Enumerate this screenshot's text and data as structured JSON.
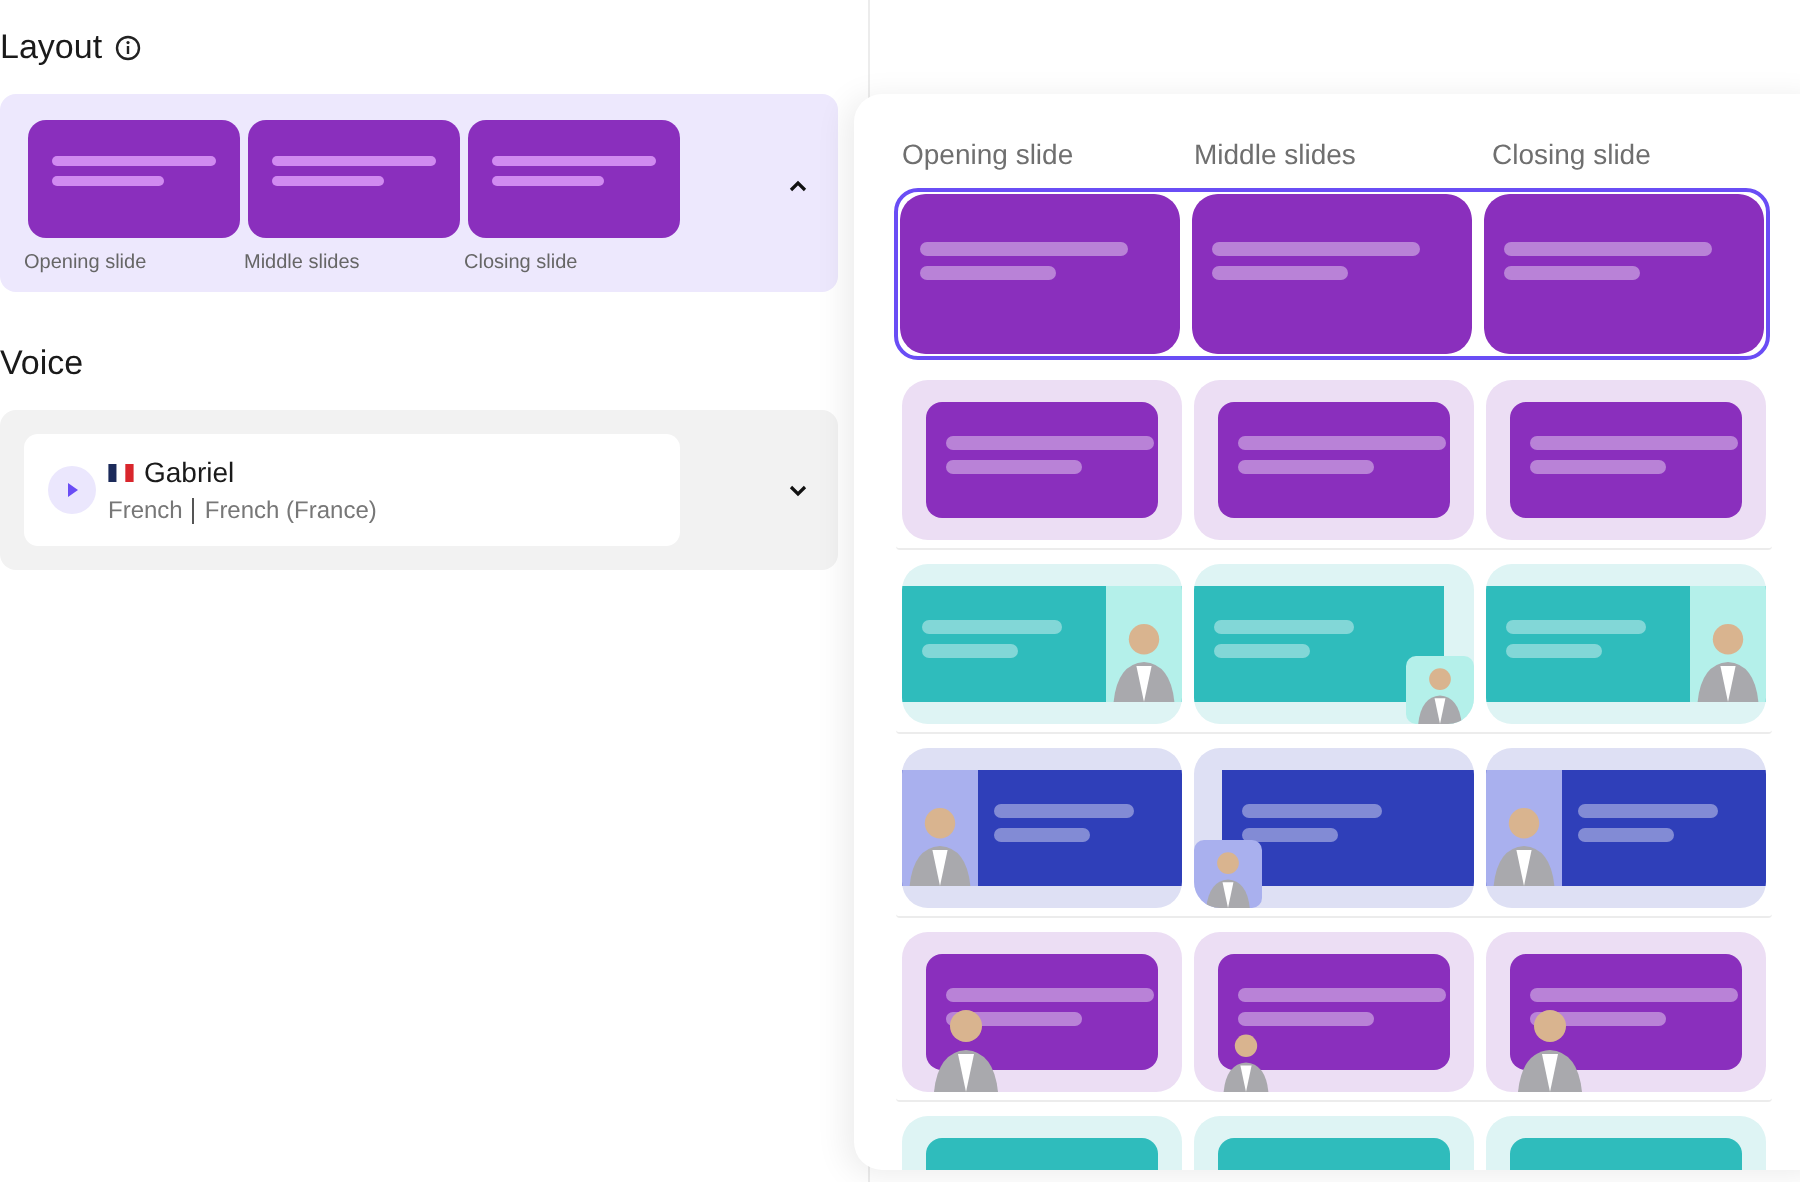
{
  "layout": {
    "title": "Layout",
    "selected_slides": [
      {
        "label": "Opening slide"
      },
      {
        "label": "Middle slides"
      },
      {
        "label": "Closing slide"
      }
    ],
    "expanded": true
  },
  "voice": {
    "title": "Voice",
    "name": "Gabriel",
    "language": "French",
    "locale": "French (France)",
    "expanded": false
  },
  "picker": {
    "columns": [
      "Opening slide",
      "Middle slides",
      "Closing slide"
    ],
    "rows": [
      {
        "selected": true,
        "color": "#8a2fbd",
        "cells": [
          {
            "kind": "full"
          },
          {
            "kind": "full"
          },
          {
            "kind": "full"
          }
        ]
      },
      {
        "selected": false,
        "color": "#8a2fbd",
        "cells": [
          {
            "kind": "inset"
          },
          {
            "kind": "inset"
          },
          {
            "kind": "inset"
          }
        ]
      },
      {
        "selected": false,
        "color": "#2fbcbc",
        "cells": [
          {
            "kind": "avatar-right"
          },
          {
            "kind": "corner-right"
          },
          {
            "kind": "avatar-right"
          }
        ]
      },
      {
        "selected": false,
        "color": "#2f3fb9",
        "cells": [
          {
            "kind": "avatar-left"
          },
          {
            "kind": "corner-left"
          },
          {
            "kind": "avatar-left"
          }
        ]
      },
      {
        "selected": false,
        "color": "#8a2fbd",
        "cells": [
          {
            "kind": "bottom-left"
          },
          {
            "kind": "bottom-left-small"
          },
          {
            "kind": "bottom-left"
          }
        ]
      },
      {
        "selected": false,
        "color": "#2fbcbc",
        "cells": [
          {
            "kind": "inset"
          },
          {
            "kind": "inset"
          },
          {
            "kind": "inset"
          }
        ]
      }
    ]
  }
}
